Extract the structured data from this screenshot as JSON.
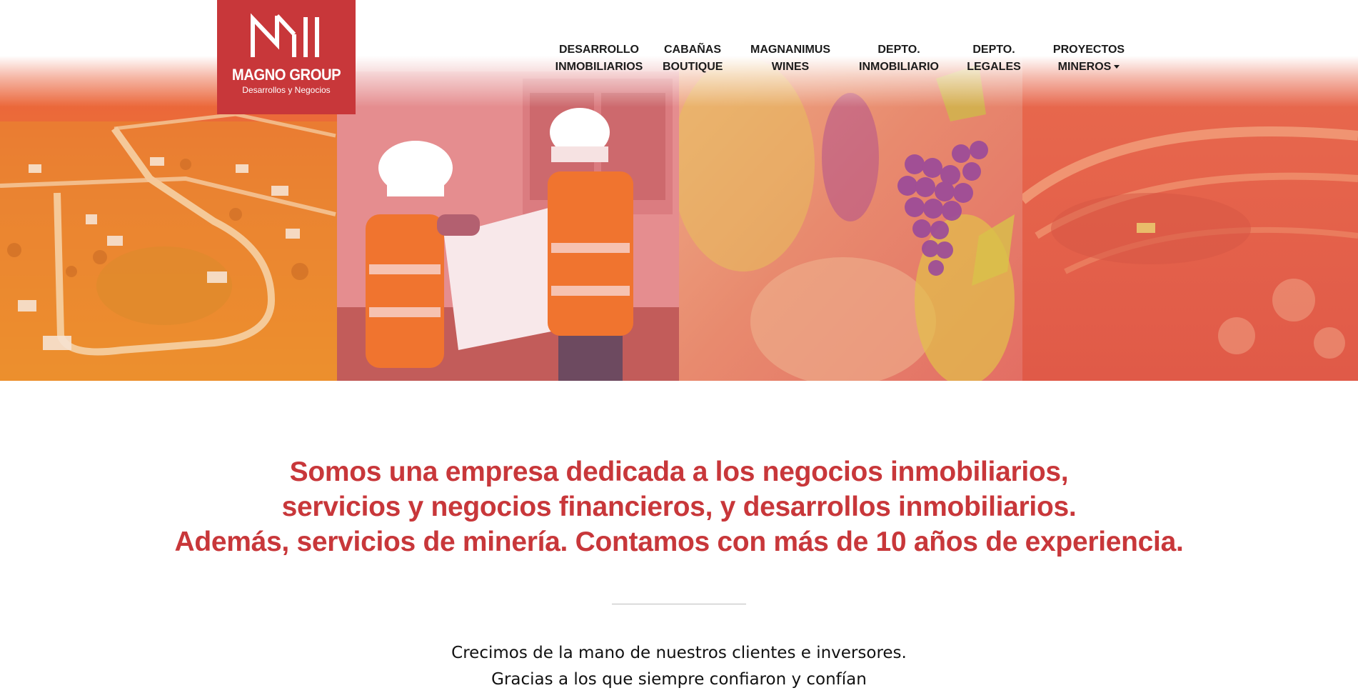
{
  "brand": {
    "name": "MAGNO GROUP",
    "tagline": "Desarrollos y Negocios",
    "color": "#c8373a"
  },
  "nav": {
    "items": [
      {
        "line1": "DESARROLLO",
        "line2": "INMOBILIARIOS"
      },
      {
        "line1": "CABAÑAS",
        "line2": "BOUTIQUE"
      },
      {
        "line1": "MAGNANIMUS",
        "line2": "WINES"
      },
      {
        "line1": "DEPTO.",
        "line2": "INMOBILIARIO"
      },
      {
        "line1": "DEPTO.",
        "line2": "LEGALES"
      },
      {
        "line1": "PROYECTOS",
        "line2": "MINEROS",
        "dropdown": true
      }
    ]
  },
  "hero": {
    "panels": [
      {
        "subject": "aerial-neighborhood",
        "icon": "aerial-lots-image"
      },
      {
        "subject": "engineers-with-plans",
        "icon": "construction-workers-image"
      },
      {
        "subject": "grape-vineyard",
        "icon": "grapes-image"
      },
      {
        "subject": "open-pit-mine",
        "icon": "mine-image"
      }
    ]
  },
  "headline": {
    "line1": "Somos una empresa dedicada a los negocios inmobiliarios,",
    "line2": "servicios y negocios financieros, y desarrollos inmobiliarios.",
    "line3": "Además, servicios de minería. Contamos con más de 10 años de experiencia."
  },
  "subtext": {
    "line1": "Crecimos de la mano de nuestros clientes e inversores.",
    "line2": "Gracias a los que siempre confiaron y confían"
  }
}
